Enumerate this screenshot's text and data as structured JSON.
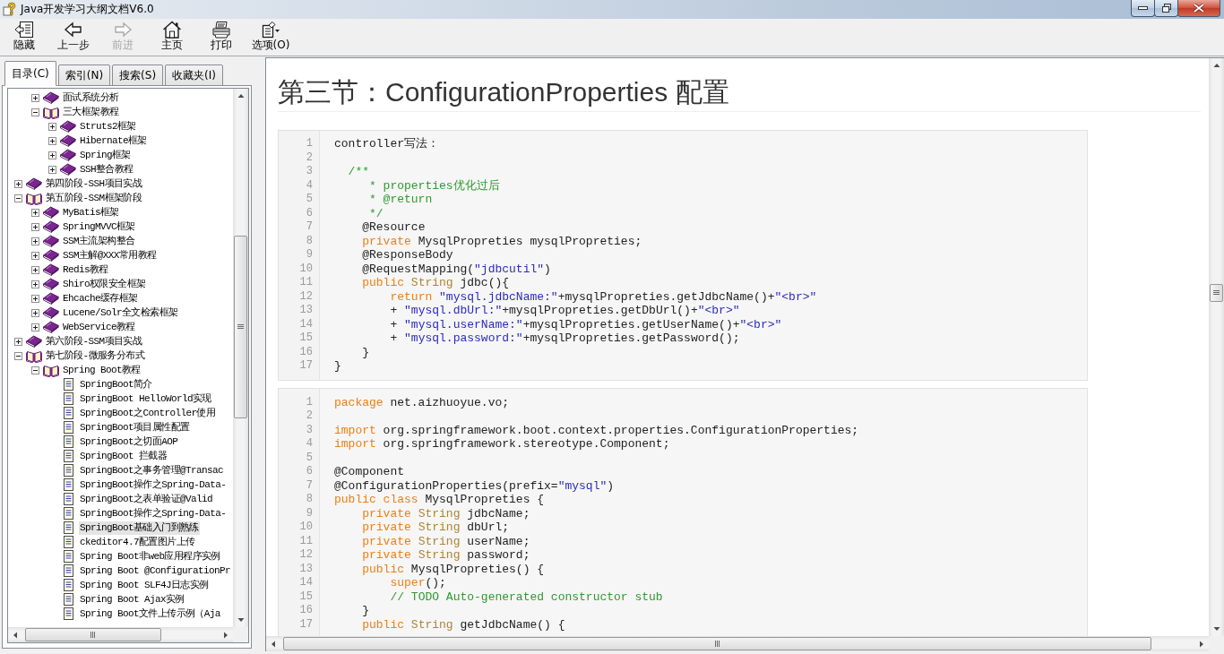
{
  "window": {
    "title": "Java开发学习大纲文档V6.0"
  },
  "toolbar": [
    {
      "label": "隐藏",
      "disabled": false
    },
    {
      "label": "上一步",
      "disabled": false
    },
    {
      "label": "前进",
      "disabled": true
    },
    {
      "label": "主页",
      "disabled": false
    },
    {
      "label": "打印",
      "disabled": false
    },
    {
      "label": "选项(O)",
      "disabled": false
    }
  ],
  "tabs": [
    {
      "label": "目录(C)",
      "selected": true
    },
    {
      "label": "索引(N)",
      "selected": false
    },
    {
      "label": "搜索(S)",
      "selected": false
    },
    {
      "label": "收藏夹(I)",
      "selected": false
    }
  ],
  "tree": {
    "children_of_hidden_parent": [
      {
        "label": "面试系统分析",
        "kind": "book",
        "expanded": false,
        "selected": false
      },
      {
        "label": "三大框架教程",
        "kind": "book",
        "expanded": true,
        "selected": false,
        "children": [
          {
            "label": "Struts2框架",
            "kind": "book",
            "expanded": false,
            "selected": false
          },
          {
            "label": "Hibernate框架",
            "kind": "book",
            "expanded": false,
            "selected": false
          },
          {
            "label": "Spring框架",
            "kind": "book",
            "expanded": false,
            "selected": false
          },
          {
            "label": "SSH整合教程",
            "kind": "book",
            "expanded": false,
            "selected": false
          }
        ]
      }
    ],
    "items": [
      {
        "label": "第四阶段-SSH项目实战",
        "kind": "book",
        "expanded": false,
        "selected": false
      },
      {
        "label": "第五阶段-SSM框架阶段",
        "kind": "book",
        "expanded": true,
        "selected": false,
        "children": [
          {
            "label": "MyBatis框架",
            "kind": "book",
            "expanded": false,
            "selected": false
          },
          {
            "label": "SpringMVVC框架",
            "kind": "book",
            "expanded": false,
            "selected": false
          },
          {
            "label": "SSM主流架构整合",
            "kind": "book",
            "expanded": false,
            "selected": false
          },
          {
            "label": "SSM主解@XXX常用教程",
            "kind": "book",
            "expanded": false,
            "selected": false
          },
          {
            "label": "Redis教程",
            "kind": "book",
            "expanded": false,
            "selected": false
          },
          {
            "label": "Shiro权限安全框架",
            "kind": "book",
            "expanded": false,
            "selected": false
          },
          {
            "label": "Ehcache缓存框架",
            "kind": "book",
            "expanded": false,
            "selected": false
          },
          {
            "label": "Lucene/Solr全文检索框架",
            "kind": "book",
            "expanded": false,
            "selected": false
          },
          {
            "label": "WebService教程",
            "kind": "book",
            "expanded": false,
            "selected": false
          }
        ]
      },
      {
        "label": "第六阶段-SSM项目实战",
        "kind": "book",
        "expanded": false,
        "selected": false
      },
      {
        "label": "第七阶段-微服务分布式",
        "kind": "book",
        "expanded": true,
        "selected": false,
        "children": [
          {
            "label": "Spring Boot教程",
            "kind": "book",
            "expanded": true,
            "selected": false,
            "children": [
              {
                "label": "SpringBoot简介",
                "kind": "page",
                "selected": false
              },
              {
                "label": "SpringBoot HelloWorld实现",
                "kind": "page",
                "selected": false
              },
              {
                "label": "SpringBoot之Controller使用",
                "kind": "page",
                "selected": false
              },
              {
                "label": "SpringBoot项目属性配置",
                "kind": "page",
                "selected": false
              },
              {
                "label": "SpringBoot之切面AOP",
                "kind": "page",
                "selected": false
              },
              {
                "label": "SpringBoot 拦截器",
                "kind": "page",
                "selected": false
              },
              {
                "label": "SpringBoot之事务管理@Transac",
                "kind": "page",
                "selected": false
              },
              {
                "label": "SpringBoot操作之Spring-Data-",
                "kind": "page",
                "selected": false
              },
              {
                "label": "SpringBoot之表单验证@Valid",
                "kind": "page",
                "selected": false
              },
              {
                "label": "SpringBoot操作之Spring-Data-",
                "kind": "page",
                "selected": false
              },
              {
                "label": "SpringBoot基础入门到熟练",
                "kind": "page",
                "selected": true
              },
              {
                "label": "ckeditor4.7配置图片上传",
                "kind": "page",
                "selected": false
              },
              {
                "label": "Spring Boot非web应用程序实例",
                "kind": "page",
                "selected": false
              },
              {
                "label": "Spring Boot @ConfigurationPr",
                "kind": "page",
                "selected": false
              },
              {
                "label": "Spring Boot SLF4J日志实例",
                "kind": "page",
                "selected": false
              },
              {
                "label": "Spring Boot Ajax实例",
                "kind": "page",
                "selected": false
              },
              {
                "label": "Spring Boot文件上传示例（Aja",
                "kind": "page",
                "selected": false
              }
            ]
          }
        ]
      }
    ]
  },
  "article": {
    "heading": "第三节：ConfigurationProperties 配置",
    "code_blocks": [
      {
        "lines": [
          {
            "number": "1",
            "tokens": [
              {
                "kind": "plain",
                "text": "controller写法："
              }
            ]
          },
          {
            "number": "2"
          },
          {
            "number": "3",
            "tokens": [
              {
                "kind": "comment",
                "text": "  /**"
              }
            ]
          },
          {
            "number": "4",
            "tokens": [
              {
                "kind": "comment",
                "text": "     * properties优化过后"
              }
            ]
          },
          {
            "number": "5",
            "tokens": [
              {
                "kind": "comment",
                "text": "     * @return"
              }
            ]
          },
          {
            "number": "6",
            "tokens": [
              {
                "kind": "comment",
                "text": "     */"
              }
            ]
          },
          {
            "number": "7",
            "tokens": [
              {
                "kind": "plain",
                "text": "    @Resource"
              }
            ]
          },
          {
            "number": "8",
            "tokens": [
              {
                "kind": "keyword",
                "text": "    private"
              },
              {
                "kind": "plain",
                "text": " MysqlPropreties mysqlPropreties;"
              }
            ]
          },
          {
            "number": "9",
            "tokens": [
              {
                "kind": "plain",
                "text": "    @ResponseBody"
              }
            ]
          },
          {
            "number": "10",
            "tokens": [
              {
                "kind": "plain",
                "text": "    @RequestMapping("
              },
              {
                "kind": "string",
                "text": "\"jdbcutil\""
              },
              {
                "kind": "plain",
                "text": ")"
              }
            ]
          },
          {
            "number": "11",
            "tokens": [
              {
                "kind": "keyword",
                "text": "    public "
              },
              {
                "kind": "type",
                "text": "String"
              },
              {
                "kind": "plain",
                "text": " jdbc(){"
              }
            ]
          },
          {
            "number": "12",
            "tokens": [
              {
                "kind": "keyword",
                "text": "        return "
              },
              {
                "kind": "string",
                "text": "\"mysql.jdbcName:\""
              },
              {
                "kind": "plain",
                "text": "+mysqlPropreties.getJdbcName()+"
              },
              {
                "kind": "string",
                "text": "\"<br>\""
              }
            ]
          },
          {
            "number": "13",
            "tokens": [
              {
                "kind": "plain",
                "text": "        + "
              },
              {
                "kind": "string",
                "text": "\"mysql.dbUrl:\""
              },
              {
                "kind": "plain",
                "text": "+mysqlPropreties.getDbUrl()+"
              },
              {
                "kind": "string",
                "text": "\"<br>\""
              }
            ]
          },
          {
            "number": "14",
            "tokens": [
              {
                "kind": "plain",
                "text": "        + "
              },
              {
                "kind": "string",
                "text": "\"mysql.userName:\""
              },
              {
                "kind": "plain",
                "text": "+mysqlPropreties.getUserName()+"
              },
              {
                "kind": "string",
                "text": "\"<br>\""
              }
            ]
          },
          {
            "number": "15",
            "tokens": [
              {
                "kind": "plain",
                "text": "        + "
              },
              {
                "kind": "string",
                "text": "\"mysql.password:\""
              },
              {
                "kind": "plain",
                "text": "+mysqlPropreties.getPassword();"
              }
            ]
          },
          {
            "number": "16",
            "tokens": [
              {
                "kind": "plain",
                "text": "    }"
              }
            ]
          },
          {
            "number": "17",
            "tokens": [
              {
                "kind": "plain",
                "text": "}"
              }
            ]
          }
        ]
      },
      {
        "lines": [
          {
            "number": "1",
            "tokens": [
              {
                "kind": "keyword",
                "text": "package"
              },
              {
                "kind": "plain",
                "text": " net.aizhuoyue.vo;"
              }
            ]
          },
          {
            "number": "2"
          },
          {
            "number": "3",
            "tokens": [
              {
                "kind": "keyword",
                "text": "import"
              },
              {
                "kind": "plain",
                "text": " org.springframework.boot.context.properties.ConfigurationProperties;"
              }
            ]
          },
          {
            "number": "4",
            "tokens": [
              {
                "kind": "keyword",
                "text": "import"
              },
              {
                "kind": "plain",
                "text": " org.springframework.stereotype.Component;"
              }
            ]
          },
          {
            "number": "5"
          },
          {
            "number": "6",
            "tokens": [
              {
                "kind": "plain",
                "text": "@Component"
              }
            ]
          },
          {
            "number": "7",
            "tokens": [
              {
                "kind": "plain",
                "text": "@ConfigurationProperties(prefix="
              },
              {
                "kind": "string",
                "text": "\"mysql\""
              },
              {
                "kind": "plain",
                "text": ")"
              }
            ]
          },
          {
            "number": "8",
            "tokens": [
              {
                "kind": "keyword",
                "text": "public "
              },
              {
                "kind": "keyword",
                "text": "class"
              },
              {
                "kind": "plain",
                "text": " MysqlPropreties {"
              }
            ]
          },
          {
            "number": "9",
            "tokens": [
              {
                "kind": "keyword",
                "text": "    private "
              },
              {
                "kind": "type",
                "text": "String"
              },
              {
                "kind": "plain",
                "text": " jdbcName;"
              }
            ]
          },
          {
            "number": "10",
            "tokens": [
              {
                "kind": "keyword",
                "text": "    private "
              },
              {
                "kind": "type",
                "text": "String"
              },
              {
                "kind": "plain",
                "text": " dbUrl;"
              }
            ]
          },
          {
            "number": "11",
            "tokens": [
              {
                "kind": "keyword",
                "text": "    private "
              },
              {
                "kind": "type",
                "text": "String"
              },
              {
                "kind": "plain",
                "text": " userName;"
              }
            ]
          },
          {
            "number": "12",
            "tokens": [
              {
                "kind": "keyword",
                "text": "    private "
              },
              {
                "kind": "type",
                "text": "String"
              },
              {
                "kind": "plain",
                "text": " password;"
              }
            ]
          },
          {
            "number": "13",
            "tokens": [
              {
                "kind": "keyword",
                "text": "    public"
              },
              {
                "kind": "plain",
                "text": " MysqlPropreties() {"
              }
            ]
          },
          {
            "number": "14",
            "tokens": [
              {
                "kind": "keyword",
                "text": "        super"
              },
              {
                "kind": "plain",
                "text": "();"
              }
            ]
          },
          {
            "number": "15",
            "tokens": [
              {
                "kind": "comment",
                "text": "        // TODO Auto-generated constructor stub"
              }
            ]
          },
          {
            "number": "16",
            "tokens": [
              {
                "kind": "plain",
                "text": "    }"
              }
            ]
          },
          {
            "number": "17",
            "tokens": [
              {
                "kind": "keyword",
                "text": "    public "
              },
              {
                "kind": "type",
                "text": "String"
              },
              {
                "kind": "plain",
                "text": " getJdbcName() {"
              }
            ]
          }
        ]
      }
    ]
  }
}
